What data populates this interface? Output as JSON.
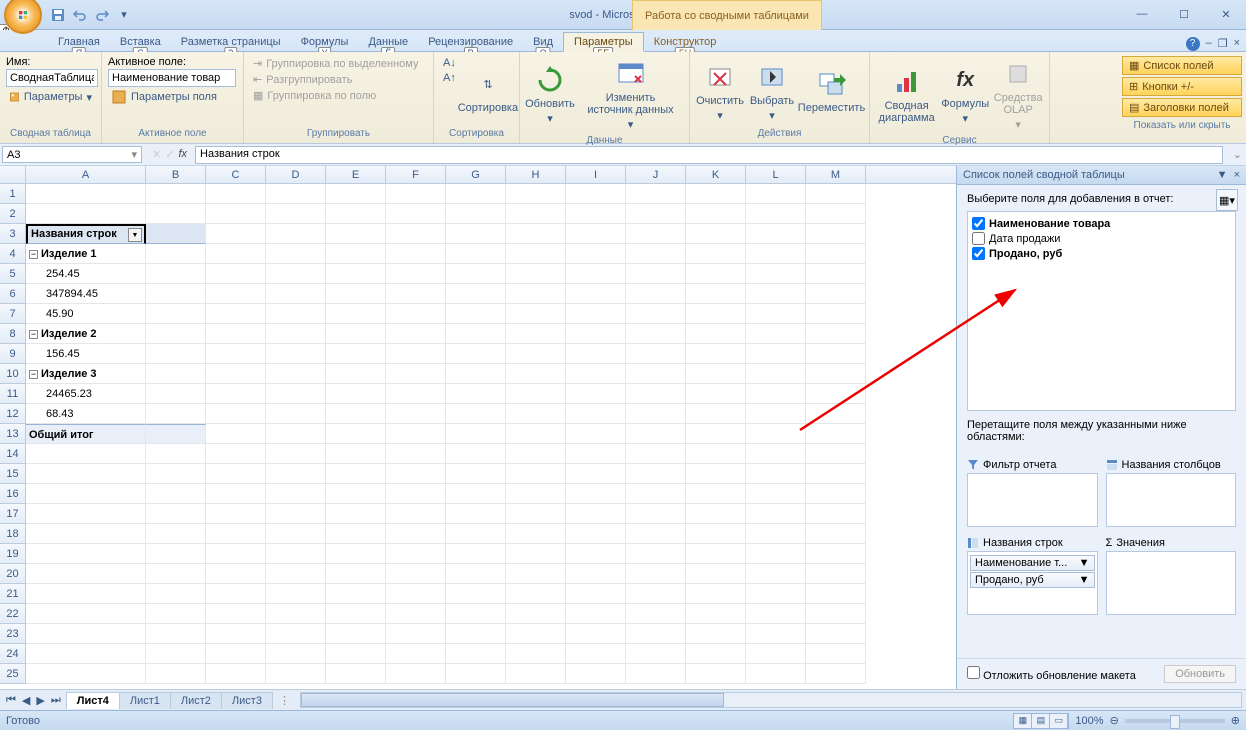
{
  "title": {
    "doc": "svod",
    "app": "Microsoft Excel",
    "context": "Работа со сводными таблицами"
  },
  "tabs": {
    "t0": "Главная",
    "t1": "Вставка",
    "t2": "Разметка страницы",
    "t3": "Формулы",
    "t4": "Данные",
    "t5": "Рецензирование",
    "t6": "Вид",
    "t7": "Параметры",
    "t8": "Конструктор",
    "k0": "Ф",
    "k1": "Я",
    "k2": "С",
    "k3": "З",
    "k4": "У",
    "k5": "Ё",
    "k6": "Р",
    "k7": "О",
    "k8": "БЕ",
    "k9": "БН"
  },
  "ribbon": {
    "g1": {
      "label": "Сводная таблица",
      "name_label": "Имя:",
      "name_value": "СводнаяТаблица",
      "params": "Параметры"
    },
    "g2": {
      "label": "Активное поле",
      "title": "Активное поле:",
      "value": "Наименование товар",
      "params": "Параметры поля"
    },
    "g3": {
      "label": "Группировать",
      "b1": "Группировка по выделенному",
      "b2": "Разгруппировать",
      "b3": "Группировка по полю"
    },
    "g4": {
      "label": "Сортировка",
      "b": "Сортировка"
    },
    "g5": {
      "label": "Данные",
      "b1": "Обновить",
      "b2": "Изменить источник данных"
    },
    "g6": {
      "label": "Действия",
      "b1": "Очистить",
      "b2": "Выбрать",
      "b3": "Переместить"
    },
    "g7": {
      "label": "Сервис",
      "b1": "Сводная диаграмма",
      "b2": "Формулы",
      "b3": "Средства OLAP"
    },
    "right": {
      "b1": "Список полей",
      "b2": "Кнопки +/-",
      "b3": "Заголовки полей",
      "label": "Показать или скрыть"
    }
  },
  "namebox": "A3",
  "formula": "Названия строк",
  "columns": [
    "A",
    "B",
    "C",
    "D",
    "E",
    "F",
    "G",
    "H",
    "I",
    "J",
    "K",
    "L",
    "M"
  ],
  "rows": [
    {
      "n": 1,
      "cells": [
        ""
      ]
    },
    {
      "n": 2,
      "cells": [
        ""
      ]
    },
    {
      "n": 3,
      "cells": [
        "Названия строк"
      ],
      "header": true,
      "selected": true
    },
    {
      "n": 4,
      "cells": [
        "Изделие 1"
      ],
      "group": true
    },
    {
      "n": 5,
      "cells": [
        "254.45"
      ],
      "indent": true
    },
    {
      "n": 6,
      "cells": [
        "347894.45"
      ],
      "indent": true
    },
    {
      "n": 7,
      "cells": [
        "45.90"
      ],
      "indent": true
    },
    {
      "n": 8,
      "cells": [
        "Изделие 2"
      ],
      "group": true
    },
    {
      "n": 9,
      "cells": [
        "156.45"
      ],
      "indent": true
    },
    {
      "n": 10,
      "cells": [
        "Изделие 3"
      ],
      "group": true
    },
    {
      "n": 11,
      "cells": [
        "24465.23"
      ],
      "indent": true
    },
    {
      "n": 12,
      "cells": [
        "68.43"
      ],
      "indent": true
    },
    {
      "n": 13,
      "cells": [
        "Общий итог"
      ],
      "total": true
    }
  ],
  "pane": {
    "title": "Список полей сводной таблицы",
    "choose": "Выберите поля для добавления в отчет:",
    "fields": {
      "f1": "Наименование товара",
      "f2": "Дата продажи",
      "f3": "Продано, руб"
    },
    "drag": "Перетащите поля между указанными ниже областями:",
    "a1": "Фильтр отчета",
    "a2": "Названия столбцов",
    "a3": "Названия строк",
    "a4": "Значения",
    "rowitems": {
      "i1": "Наименование т...",
      "i2": "Продано, руб"
    },
    "defer": "Отложить обновление макета",
    "update": "Обновить"
  },
  "sheets": {
    "s1": "Лист4",
    "s2": "Лист1",
    "s3": "Лист2",
    "s4": "Лист3"
  },
  "status": {
    "ready": "Готово",
    "zoom": "100%"
  }
}
